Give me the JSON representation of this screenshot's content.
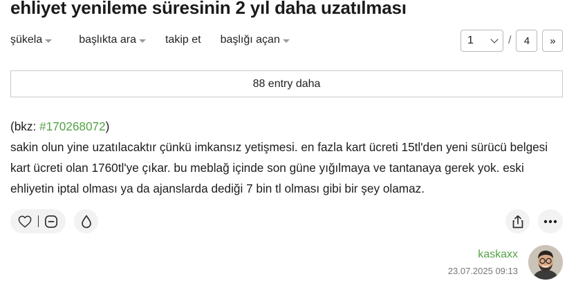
{
  "topic": {
    "title": "ehliyet yenileme süresinin 2 yıl daha uzatılması"
  },
  "toolbar": {
    "sukela": "şükela",
    "search_in_topic": "başlıkta ara",
    "follow": "takip et",
    "topic_opener": "başlığı açan"
  },
  "pager": {
    "current_page": "1",
    "separator": "/",
    "total_pages": "4",
    "next_label": "»"
  },
  "more_entries": {
    "label": "88 entry daha"
  },
  "entry": {
    "bkz_prefix": "(bkz: ",
    "bkz_link": "#170268072",
    "bkz_suffix": ")",
    "body": "sakin olun yine uzatılacaktır çünkü imkansız yetişmesi. en fazla kart ücreti 15tl'den yeni sürücü belgesi kart ücreti olan 1760tl'ye çıkar. bu meblağ içinde son güne yığılmaya ve tantanaya gerek yok. eski ehliyetin iptal olması ya da ajanslarda dediği 7 bin tl olması gibi bir şey olamaz.",
    "author": "kaskaxx",
    "date": "23.07.2025 09:13"
  },
  "icons": {
    "like": "heart-icon",
    "dislike": "minus-circle-icon",
    "favorite": "drop-icon",
    "share": "share-icon",
    "more": "ellipsis-icon"
  },
  "colors": {
    "link_green": "#53a245",
    "pill_bg": "#f2f2f2",
    "border": "#c9c9c9"
  }
}
